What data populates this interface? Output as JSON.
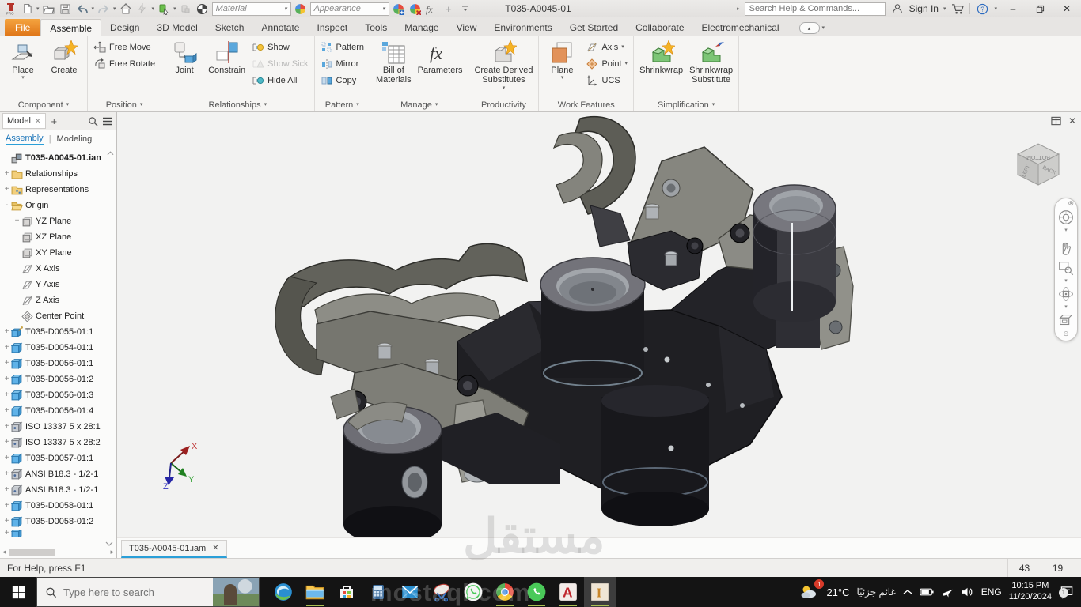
{
  "titlebar": {
    "title": "T035-A0045-01",
    "material_value": "Material",
    "appearance_value": "Appearance",
    "search_placeholder": "Search Help & Commands...",
    "sign_in_label": "Sign In"
  },
  "ribbon": {
    "tabs": [
      "File",
      "Assemble",
      "Design",
      "3D Model",
      "Sketch",
      "Annotate",
      "Inspect",
      "Tools",
      "Manage",
      "View",
      "Environments",
      "Get Started",
      "Collaborate",
      "Electromechanical"
    ],
    "active_tab": "Assemble",
    "panels": [
      {
        "title": "Component",
        "caret": true,
        "groups": [
          {
            "type": "large",
            "items": [
              {
                "label": "Place",
                "icon": "place",
                "caret": true
              },
              {
                "label": "Create",
                "icon": "create"
              }
            ]
          }
        ]
      },
      {
        "title": "Position",
        "caret": true,
        "groups": [
          {
            "type": "small",
            "items": [
              {
                "label": "Free Move",
                "icon": "free-move"
              },
              {
                "label": "Free Rotate",
                "icon": "free-rotate"
              }
            ]
          }
        ]
      },
      {
        "title": "Relationships",
        "caret": true,
        "groups": [
          {
            "type": "large",
            "items": [
              {
                "label": "Joint",
                "icon": "joint"
              },
              {
                "label": "Constrain",
                "icon": "constrain"
              }
            ]
          },
          {
            "type": "small",
            "items": [
              {
                "label": "Show",
                "icon": "show"
              },
              {
                "label": "Show Sick",
                "icon": "show-sick",
                "disabled": true
              },
              {
                "label": "Hide All",
                "icon": "hide-all"
              }
            ]
          }
        ]
      },
      {
        "title": "Pattern",
        "caret": true,
        "groups": [
          {
            "type": "small",
            "items": [
              {
                "label": "Pattern",
                "icon": "pattern"
              },
              {
                "label": "Mirror",
                "icon": "mirror"
              },
              {
                "label": "Copy",
                "icon": "copy"
              }
            ]
          }
        ]
      },
      {
        "title": "Manage",
        "caret": true,
        "groups": [
          {
            "type": "large",
            "items": [
              {
                "label": "Bill of\nMaterials",
                "icon": "bom"
              },
              {
                "label": "Parameters",
                "icon": "parameters"
              }
            ]
          }
        ]
      },
      {
        "title": "Productivity",
        "caret": false,
        "groups": [
          {
            "type": "large",
            "items": [
              {
                "label": "Create Derived\nSubstitutes",
                "icon": "derived",
                "caret": true
              }
            ]
          }
        ]
      },
      {
        "title": "Work Features",
        "caret": false,
        "groups": [
          {
            "type": "large",
            "items": [
              {
                "label": "Plane",
                "icon": "plane-wf",
                "caret": true
              }
            ]
          },
          {
            "type": "small",
            "items": [
              {
                "label": "Axis",
                "icon": "axis-wf",
                "caret": true
              },
              {
                "label": "Point",
                "icon": "point-wf",
                "caret": true
              },
              {
                "label": "UCS",
                "icon": "ucs"
              }
            ]
          }
        ]
      },
      {
        "title": "Simplification",
        "caret": true,
        "groups": [
          {
            "type": "large",
            "items": [
              {
                "label": "Shrinkwrap",
                "icon": "shrinkwrap"
              },
              {
                "label": "Shrinkwrap\nSubstitute",
                "icon": "shrinkwrap-substitute"
              }
            ]
          }
        ]
      }
    ]
  },
  "browser": {
    "panel_tab": "Model",
    "mode_tabs": [
      "Assembly",
      "Modeling"
    ],
    "active_mode": "Assembly",
    "tree": [
      {
        "label": "T035-A0045-01.ian",
        "icon": "assembly",
        "exp": "",
        "depth": 0,
        "bold": true
      },
      {
        "label": "Relationships",
        "icon": "folder",
        "exp": "+",
        "depth": 0
      },
      {
        "label": "Representations",
        "icon": "representations",
        "exp": "+",
        "depth": 0
      },
      {
        "label": "Origin",
        "icon": "folder-open",
        "exp": "-",
        "depth": 0
      },
      {
        "label": "YZ Plane",
        "icon": "plane",
        "exp": "+",
        "depth": 1
      },
      {
        "label": "XZ Plane",
        "icon": "plane",
        "exp": "",
        "depth": 1
      },
      {
        "label": "XY Plane",
        "icon": "plane",
        "exp": "",
        "depth": 1
      },
      {
        "label": "X Axis",
        "icon": "axis",
        "exp": "",
        "depth": 1
      },
      {
        "label": "Y Axis",
        "icon": "axis",
        "exp": "",
        "depth": 1
      },
      {
        "label": "Z Axis",
        "icon": "axis",
        "exp": "",
        "depth": 1
      },
      {
        "label": "Center Point",
        "icon": "centerpoint",
        "exp": "",
        "depth": 1
      },
      {
        "label": "T035-D0055-01:1",
        "icon": "part-pinned",
        "exp": "+",
        "depth": 0
      },
      {
        "label": "T035-D0054-01:1",
        "icon": "part",
        "exp": "+",
        "depth": 0
      },
      {
        "label": "T035-D0056-01:1",
        "icon": "part",
        "exp": "+",
        "depth": 0
      },
      {
        "label": "T035-D0056-01:2",
        "icon": "part",
        "exp": "+",
        "depth": 0
      },
      {
        "label": "T035-D0056-01:3",
        "icon": "part",
        "exp": "+",
        "depth": 0
      },
      {
        "label": "T035-D0056-01:4",
        "icon": "part",
        "exp": "+",
        "depth": 0
      },
      {
        "label": "ISO 13337 5 x 28:1",
        "icon": "library-part",
        "exp": "+",
        "depth": 0
      },
      {
        "label": "ISO 13337 5 x 28:2",
        "icon": "library-part",
        "exp": "+",
        "depth": 0
      },
      {
        "label": "T035-D0057-01:1",
        "icon": "part",
        "exp": "+",
        "depth": 0
      },
      {
        "label": "ANSI B18.3 - 1/2-1",
        "icon": "library-part",
        "exp": "+",
        "depth": 0
      },
      {
        "label": "ANSI B18.3 - 1/2-1",
        "icon": "library-part",
        "exp": "+",
        "depth": 0
      },
      {
        "label": "T035-D0058-01:1",
        "icon": "part",
        "exp": "+",
        "depth": 0
      },
      {
        "label": "T035-D0058-01:2",
        "icon": "part",
        "exp": "+",
        "depth": 0
      },
      {
        "label": "",
        "icon": "part",
        "exp": "+",
        "depth": 0,
        "partial": true
      }
    ]
  },
  "viewport": {
    "document_tab": "T035-A0045-01.iam",
    "viewcube": [
      "BOTTOM",
      "LEFT",
      "BACK"
    ],
    "triad": [
      "X",
      "Y",
      "Z"
    ]
  },
  "statusbar": {
    "help_text": "For Help, press F1",
    "counts": [
      "43",
      "19"
    ]
  },
  "taskbar": {
    "search_placeholder": "Type here to search",
    "icons": [
      {
        "name": "edge"
      },
      {
        "name": "file-explorer",
        "running": true
      },
      {
        "name": "store"
      },
      {
        "name": "calculator"
      },
      {
        "name": "mail"
      },
      {
        "name": "snipping-tool"
      },
      {
        "name": "whatsapp-light"
      },
      {
        "name": "chrome",
        "running": true
      },
      {
        "name": "whatsapp",
        "running": true
      },
      {
        "name": "autocad",
        "running": true
      },
      {
        "name": "inventor",
        "running": true,
        "active": true
      }
    ],
    "weather_temp": "21°C",
    "weather_desc": "غائم جزئيًا",
    "weather_badge": "1",
    "language": "ENG",
    "time": "10:15 PM",
    "date": "11/20/2024",
    "notification_badge": "1"
  },
  "watermark": {
    "arabic": "مستقل",
    "latin": "mostaql.com"
  },
  "colors": {
    "accent_blue": "#2a9fd8",
    "file_tab_orange": "#e8861c",
    "taskbar_bg": "#141414",
    "viewport_bg": "#f2f2f1"
  }
}
